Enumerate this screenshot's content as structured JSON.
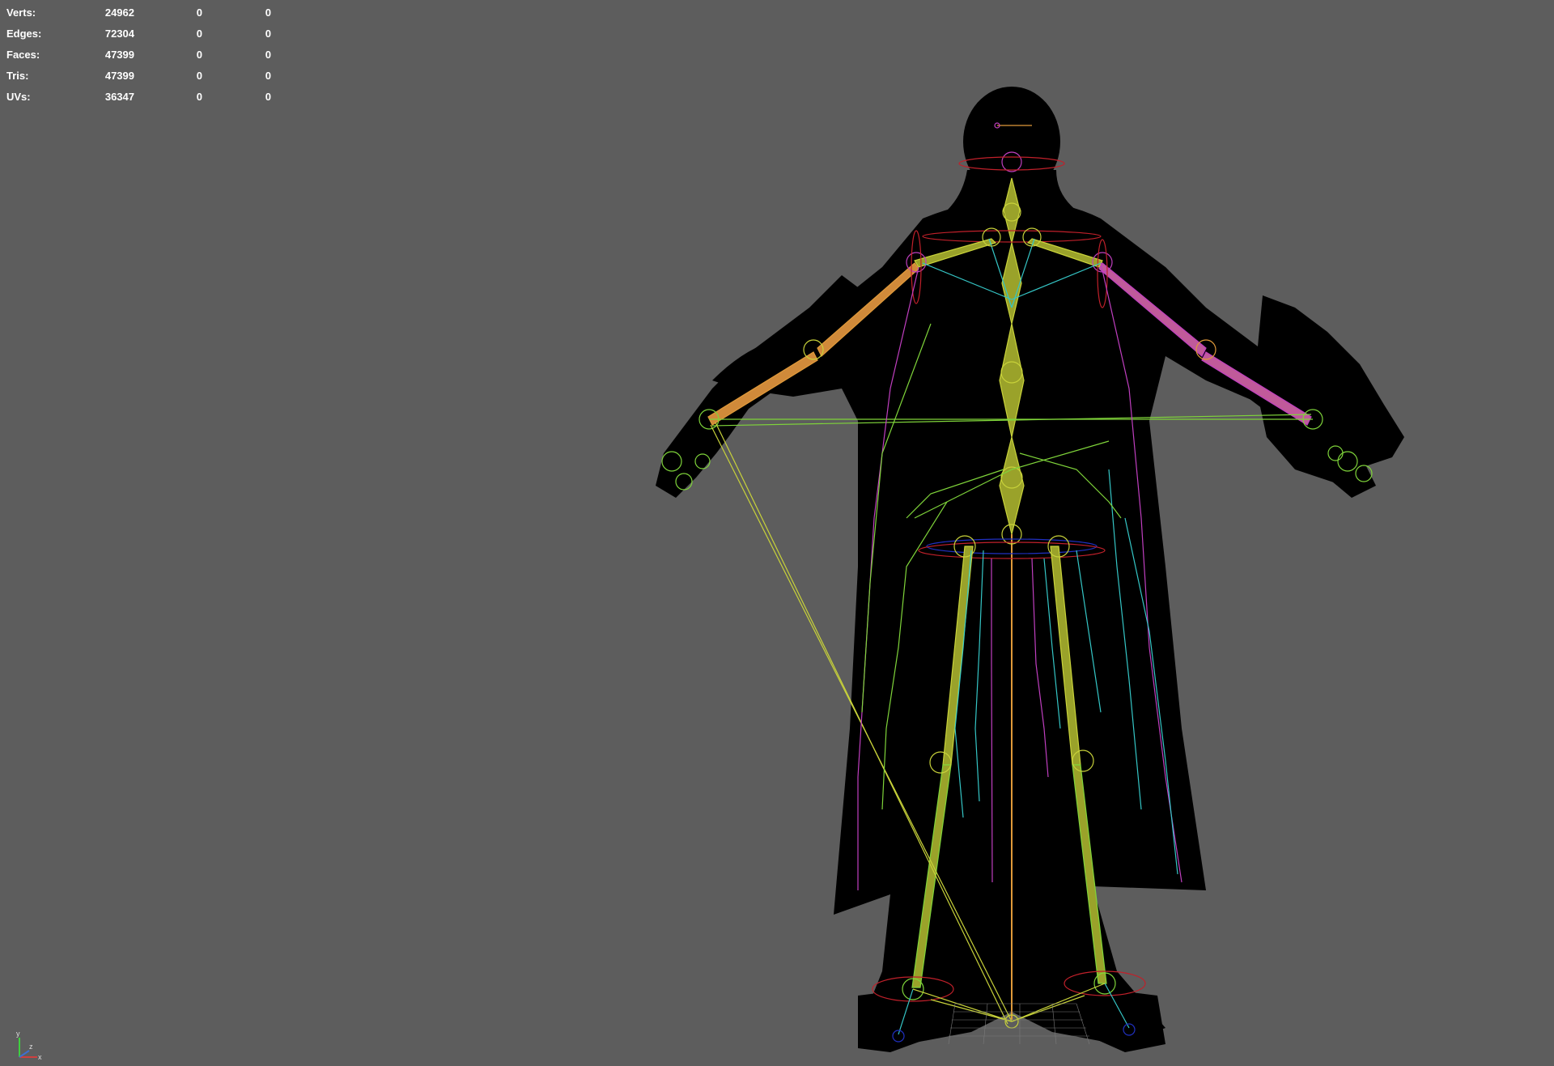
{
  "hud": {
    "rows": [
      {
        "label": "Verts:",
        "v1": "24962",
        "v2": "0",
        "v3": "0"
      },
      {
        "label": "Edges:",
        "v1": "72304",
        "v2": "0",
        "v3": "0"
      },
      {
        "label": "Faces:",
        "v1": "47399",
        "v2": "0",
        "v3": "0"
      },
      {
        "label": "Tris:",
        "v1": "47399",
        "v2": "0",
        "v3": "0"
      },
      {
        "label": "UVs:",
        "v1": "36347",
        "v2": "0",
        "v3": "0"
      }
    ]
  },
  "axis": {
    "y_label": "y",
    "x_label": "x",
    "z_label": "z"
  },
  "colors": {
    "background": "#5d5d5d",
    "silhouette": "#000000",
    "bone_yellow": "#c8d23a",
    "bone_green": "#7fd43a",
    "bone_cyan": "#35c6c6",
    "bone_magenta": "#c03fc0",
    "bone_orange": "#e09a3a",
    "control_red": "#c0202a",
    "control_blue": "#2030c0"
  }
}
